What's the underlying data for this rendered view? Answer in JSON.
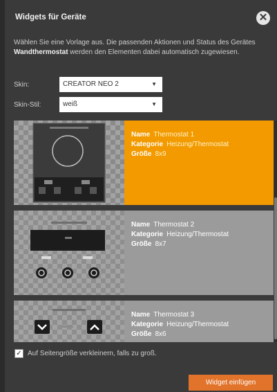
{
  "dialog": {
    "title": "Widgets für Geräte",
    "description_pre": "Wählen Sie eine Vorlage aus. Die passenden Aktionen und Status des Gerätes ",
    "description_device": "Wandthermostat",
    "description_post": " werden den Elementen dabei automatisch zugewiesen."
  },
  "skin": {
    "label": "Skin:",
    "value": "CREATOR NEO 2"
  },
  "skin_style": {
    "label": "Skin-Stil:",
    "value": "weiß"
  },
  "labels": {
    "name": "Name",
    "category": "Kategorie",
    "size": "Größe"
  },
  "widgets": [
    {
      "name": "Thermostat 1",
      "category": "Heizung/Thermostat",
      "size": "8x9",
      "selected": true
    },
    {
      "name": "Thermostat 2",
      "category": "Heizung/Thermostat",
      "size": "8x7",
      "selected": false
    },
    {
      "name": "Thermostat 3",
      "category": "Heizung/Thermostat",
      "size": "8x6",
      "selected": false
    }
  ],
  "shrink_option": {
    "label": "Auf Seitengröße verkleinern, falls zu groß.",
    "checked": true
  },
  "insert_button": {
    "label": "Widget einfügen"
  },
  "colors": {
    "accent": "#f29a00",
    "button": "#e2732b",
    "dialog_bg": "#3a3a3a"
  }
}
